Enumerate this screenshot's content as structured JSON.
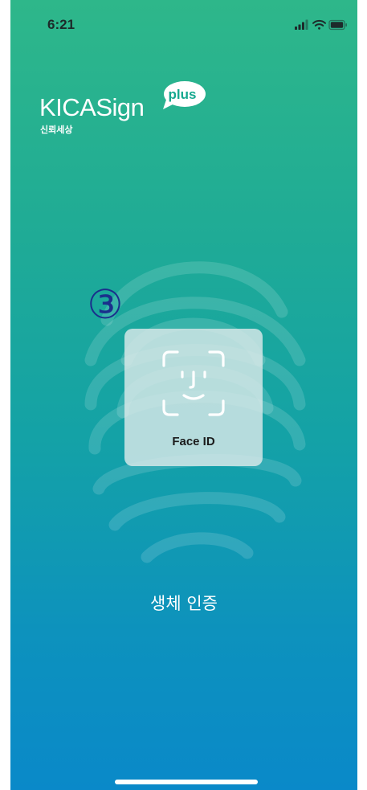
{
  "status_bar": {
    "time": "6:21",
    "icons": [
      "cellular-signal-icon",
      "wifi-icon",
      "battery-icon"
    ]
  },
  "logo": {
    "brand_text": "KICASign",
    "plus_badge": "plus",
    "subtitle": "신뢰세상"
  },
  "annotation": {
    "circled_number": "③",
    "color": "#1a2f8c"
  },
  "face_id_button": {
    "label": "Face ID",
    "icon": "face-id-icon"
  },
  "main": {
    "title": "생체 인증"
  },
  "colors": {
    "gradient_top": "#2eb78a",
    "gradient_bottom": "#0a89c9",
    "text": "#ffffff"
  }
}
